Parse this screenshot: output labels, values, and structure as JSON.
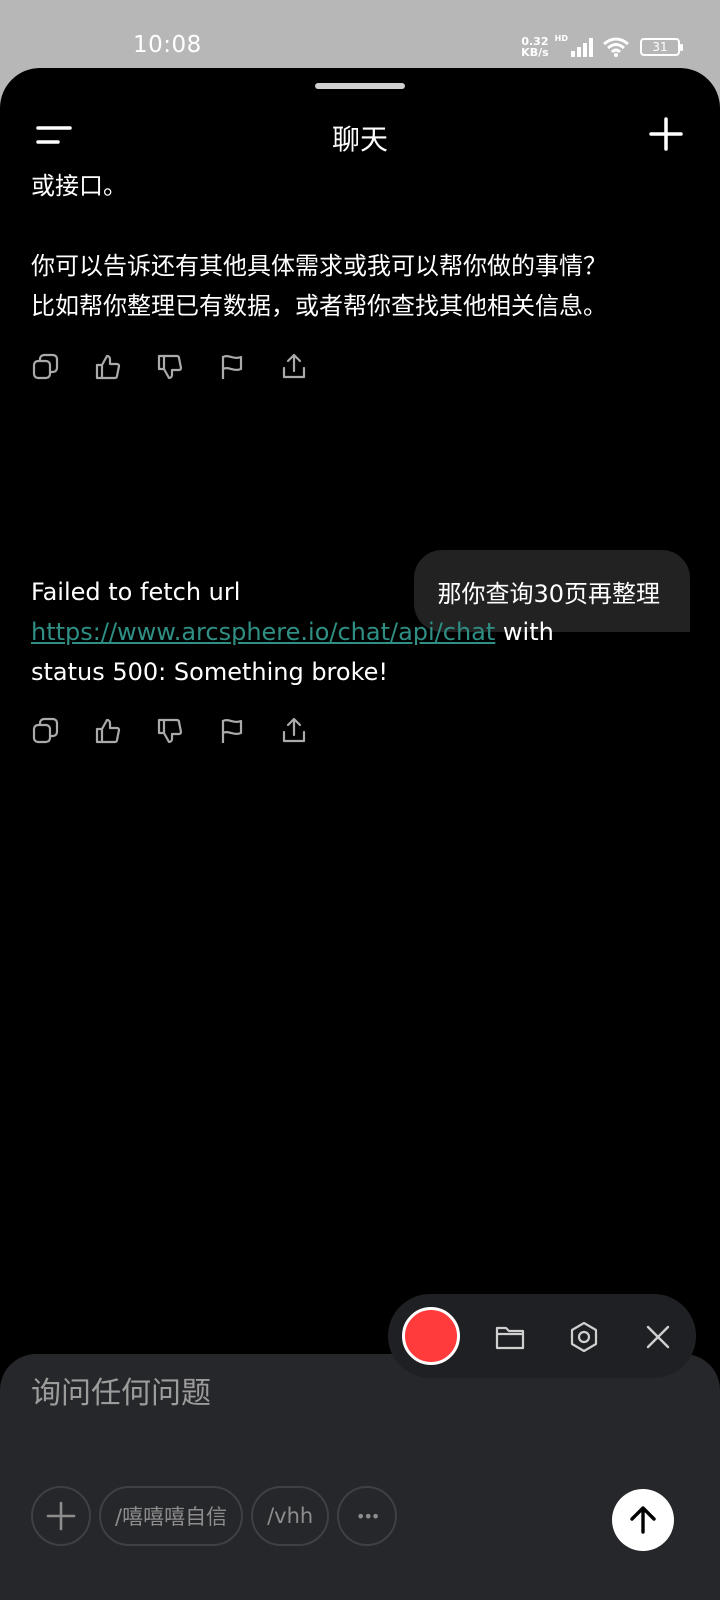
{
  "status_bar": {
    "time": "10:08",
    "net_speed_value": "0.32",
    "net_speed_unit": "KB/s",
    "network_badge": "HD",
    "battery_level": "31"
  },
  "header": {
    "title": "聊天",
    "menu_icon": "menu-icon",
    "new_chat_icon": "plus-icon"
  },
  "messages": [
    {
      "role": "assistant",
      "partial_top": "或接口。",
      "paragraph_1": "你可以告诉还有其他具体需求或我可以帮你做的事情？",
      "paragraph_2": "比如帮你整理已有数据，或者帮你查找其他相关信息。"
    },
    {
      "role": "user",
      "text": "那你查询30页再整理"
    },
    {
      "role": "assistant",
      "line_1": "Failed to fetch url",
      "link": "https://www.arcsphere.io/chat/api/chat",
      "after_link": " with",
      "line_3": "status 500: Something broke!"
    }
  ],
  "message_actions": [
    "copy-icon",
    "thumbs-up-icon",
    "thumbs-down-icon",
    "flag-icon",
    "share-icon"
  ],
  "floating_toolbar": {
    "record_color": "#ff3b3b",
    "icons": [
      "folder-icon",
      "settings-hex-icon",
      "close-icon"
    ]
  },
  "composer": {
    "placeholder": "询问任何问题",
    "value": "",
    "chips": [
      "/嘻嘻嘻自信",
      "/vhh"
    ],
    "more_label": "•••",
    "send_icon": "arrow-up-icon"
  },
  "colors": {
    "background": "#000000",
    "composer_bg": "#26272a",
    "link": "#2f8f84",
    "user_bubble": "#222222",
    "status_bar": "#b7b7b7"
  }
}
